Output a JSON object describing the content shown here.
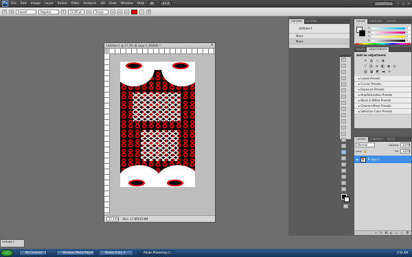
{
  "app": {
    "logo": "Ps",
    "menus": [
      "File",
      "Edit",
      "Image",
      "Layer",
      "Select",
      "Filter",
      "Analysis",
      "3D",
      "View",
      "Window",
      "Help"
    ],
    "zoom": "17.2",
    "workspace": "ESSENTIALS"
  },
  "options_bar": {
    "tool_glyph": "T",
    "font_family": "Impact",
    "font_style": "Regular",
    "font_size": "12.85 pt",
    "antialias": "Sharp",
    "text_color": "#e00000"
  },
  "document": {
    "title": "Untitled-1 @ 17.2% (8 copy 5, RGB/8) *",
    "zoom_label": "17.19%",
    "doc_info": "Doc: 17.8M/32.8M",
    "pattern_text": "888888888888888888",
    "glyph": "8"
  },
  "panels": {
    "history": {
      "tabs": [
        "HISTORY",
        "ACTIONS"
      ],
      "snapshot": "Untitled-1",
      "rows": [
        "Move",
        "Move"
      ]
    },
    "color": {
      "tabs": [
        "COLOR",
        "SWATCHES",
        "STYLES"
      ],
      "channels": [
        {
          "label": "C",
          "value": "0"
        },
        {
          "label": "M",
          "value": "0"
        },
        {
          "label": "Y",
          "value": "0"
        },
        {
          "label": "K",
          "value": "0"
        }
      ]
    },
    "adjustments": {
      "tabs": [
        "MASKS",
        "ADJUSTMENTS"
      ],
      "heading": "Add an adjustment",
      "presets": [
        "Levels Presets",
        "Curves Presets",
        "Exposure Presets",
        "Hue/Saturation Presets",
        "Black & White Presets",
        "Channel Mixer Presets",
        "Selective Color Presets"
      ]
    },
    "layers": {
      "tabs": [
        "LAYERS",
        "CHANNELS",
        "PATHS"
      ],
      "blend_mode": "Normal",
      "opacity_label": "Opacity:",
      "opacity": "100%",
      "lock_label": "Lock:",
      "fill_label": "Fill:",
      "fill": "100%",
      "active_layer": "8 copy 5"
    }
  },
  "minimized_doc": "Untitled-1",
  "taskbar": {
    "items": [
      "My Contents - PSI Sy...",
      "Windows Media Player",
      "Photos Entry 3",
      "Adobe Photoshop C..."
    ],
    "clock": "3:56 AM"
  }
}
